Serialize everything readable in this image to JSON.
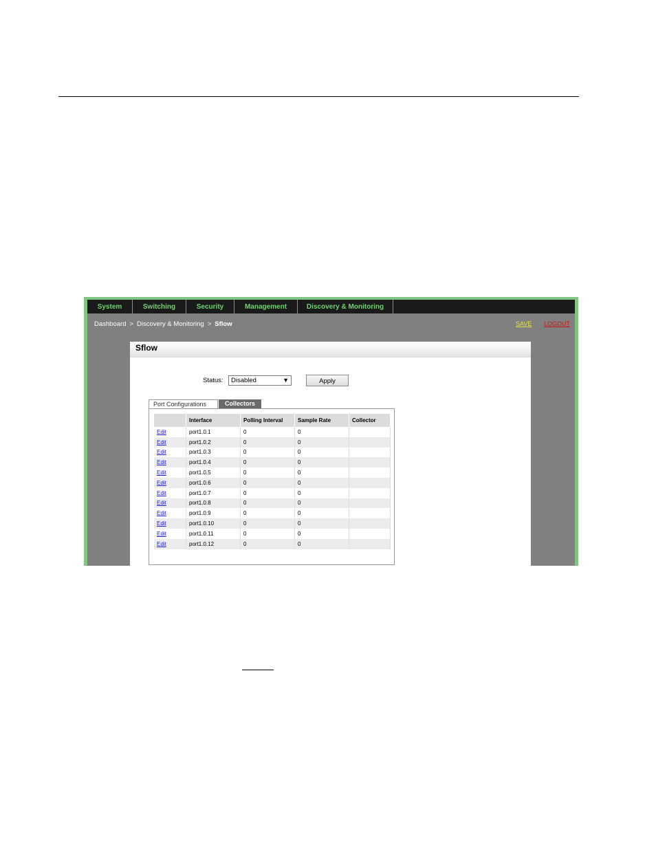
{
  "nav": {
    "items": [
      {
        "label": "System"
      },
      {
        "label": "Switching"
      },
      {
        "label": "Security"
      },
      {
        "label": "Management"
      },
      {
        "label": "Discovery & Monitoring"
      }
    ]
  },
  "breadcrumb": {
    "items": [
      "Dashboard",
      "Discovery & Monitoring",
      "Sflow"
    ],
    "separator": ">"
  },
  "header_links": {
    "save": "SAVE",
    "logout": "LOGOUT"
  },
  "panel": {
    "title": "Sflow",
    "status_label": "Status:",
    "status_value": "Disabled",
    "apply_label": "Apply"
  },
  "tabs": {
    "port_configurations": "Port Configurations",
    "collectors": "Collectors"
  },
  "table": {
    "columns": [
      "",
      "Interface",
      "Polling Interval",
      "Sample Rate",
      "Collector"
    ],
    "edit_label": "Edit",
    "rows": [
      {
        "interface": "port1.0.1",
        "polling": "0",
        "sample": "0",
        "collector": ""
      },
      {
        "interface": "port1.0.2",
        "polling": "0",
        "sample": "0",
        "collector": ""
      },
      {
        "interface": "port1.0.3",
        "polling": "0",
        "sample": "0",
        "collector": ""
      },
      {
        "interface": "port1.0.4",
        "polling": "0",
        "sample": "0",
        "collector": ""
      },
      {
        "interface": "port1.0.5",
        "polling": "0",
        "sample": "0",
        "collector": ""
      },
      {
        "interface": "port1.0.6",
        "polling": "0",
        "sample": "0",
        "collector": ""
      },
      {
        "interface": "port1.0.7",
        "polling": "0",
        "sample": "0",
        "collector": ""
      },
      {
        "interface": "port1.0.8",
        "polling": "0",
        "sample": "0",
        "collector": ""
      },
      {
        "interface": "port1.0.9",
        "polling": "0",
        "sample": "0",
        "collector": ""
      },
      {
        "interface": "port1.0.10",
        "polling": "0",
        "sample": "0",
        "collector": ""
      },
      {
        "interface": "port1.0.11",
        "polling": "0",
        "sample": "0",
        "collector": ""
      },
      {
        "interface": "port1.0.12",
        "polling": "0",
        "sample": "0",
        "collector": ""
      }
    ]
  },
  "colors": {
    "frame_green": "#82c482",
    "nav_bg": "#1a1a1a",
    "nav_text": "#6dd66d",
    "save_link": "#e6e640",
    "logout_link": "#c81414",
    "edit_link": "#1a1ad0"
  },
  "icons": {
    "dropdown": "chevron-down-icon"
  }
}
